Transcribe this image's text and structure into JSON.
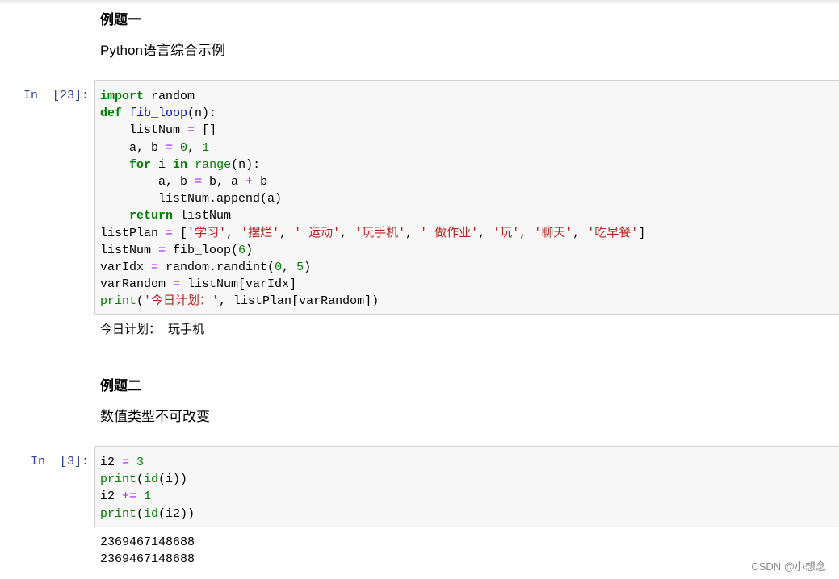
{
  "colors": {
    "keyword": "#008000",
    "builtin": "#008000",
    "number": "#008000",
    "operator": "#aa22ff",
    "string": "#ba2121",
    "function_def": "#0000ff",
    "prompt": "#303f9f"
  },
  "cells": [
    {
      "type": "markdown",
      "heading": "例题一",
      "paragraph": "Python语言综合示例"
    },
    {
      "type": "code",
      "prompt": "In  [23]:",
      "lines": [
        [
          {
            "t": "import",
            "c": "kw"
          },
          {
            "t": " random",
            "c": "n"
          }
        ],
        [
          {
            "t": "def",
            "c": "kw"
          },
          {
            "t": " ",
            "c": "n"
          },
          {
            "t": "fib_loop",
            "c": "fn"
          },
          {
            "t": "(n):",
            "c": "n"
          }
        ],
        [
          {
            "t": "    listNum ",
            "c": "n"
          },
          {
            "t": "=",
            "c": "op"
          },
          {
            "t": " []",
            "c": "n"
          }
        ],
        [
          {
            "t": "    a, b ",
            "c": "n"
          },
          {
            "t": "=",
            "c": "op"
          },
          {
            "t": " ",
            "c": "n"
          },
          {
            "t": "0",
            "c": "num"
          },
          {
            "t": ", ",
            "c": "n"
          },
          {
            "t": "1",
            "c": "num"
          }
        ],
        [
          {
            "t": "    ",
            "c": "n"
          },
          {
            "t": "for",
            "c": "kw"
          },
          {
            "t": " i ",
            "c": "n"
          },
          {
            "t": "in",
            "c": "kw"
          },
          {
            "t": " ",
            "c": "n"
          },
          {
            "t": "range",
            "c": "bi"
          },
          {
            "t": "(n):",
            "c": "n"
          }
        ],
        [
          {
            "t": "        a, b ",
            "c": "n"
          },
          {
            "t": "=",
            "c": "op"
          },
          {
            "t": " b, a ",
            "c": "n"
          },
          {
            "t": "+",
            "c": "op"
          },
          {
            "t": " b",
            "c": "n"
          }
        ],
        [
          {
            "t": "        listNum.append(a)",
            "c": "n"
          }
        ],
        [
          {
            "t": "    ",
            "c": "n"
          },
          {
            "t": "return",
            "c": "kw"
          },
          {
            "t": " listNum",
            "c": "n"
          }
        ],
        [
          {
            "t": "listPlan ",
            "c": "n"
          },
          {
            "t": "=",
            "c": "op"
          },
          {
            "t": " [",
            "c": "n"
          },
          {
            "t": "'学习'",
            "c": "str"
          },
          {
            "t": ", ",
            "c": "n"
          },
          {
            "t": "'摆烂'",
            "c": "str"
          },
          {
            "t": ", ",
            "c": "n"
          },
          {
            "t": "' 运动'",
            "c": "str"
          },
          {
            "t": ", ",
            "c": "n"
          },
          {
            "t": "'玩手机'",
            "c": "str"
          },
          {
            "t": ", ",
            "c": "n"
          },
          {
            "t": "' 做作业'",
            "c": "str"
          },
          {
            "t": ", ",
            "c": "n"
          },
          {
            "t": "'玩'",
            "c": "str"
          },
          {
            "t": ", ",
            "c": "n"
          },
          {
            "t": "'聊天'",
            "c": "str"
          },
          {
            "t": ", ",
            "c": "n"
          },
          {
            "t": "'吃早餐'",
            "c": "str"
          },
          {
            "t": "]",
            "c": "n"
          }
        ],
        [
          {
            "t": "listNum ",
            "c": "n"
          },
          {
            "t": "=",
            "c": "op"
          },
          {
            "t": " fib_loop(",
            "c": "n"
          },
          {
            "t": "6",
            "c": "num"
          },
          {
            "t": ")",
            "c": "n"
          }
        ],
        [
          {
            "t": "varIdx ",
            "c": "n"
          },
          {
            "t": "=",
            "c": "op"
          },
          {
            "t": " random.randint(",
            "c": "n"
          },
          {
            "t": "0",
            "c": "num"
          },
          {
            "t": ", ",
            "c": "n"
          },
          {
            "t": "5",
            "c": "num"
          },
          {
            "t": ")",
            "c": "n"
          }
        ],
        [
          {
            "t": "varRandom ",
            "c": "n"
          },
          {
            "t": "=",
            "c": "op"
          },
          {
            "t": " listNum[varIdx]",
            "c": "n"
          }
        ],
        [
          {
            "t": "print",
            "c": "bi"
          },
          {
            "t": "(",
            "c": "n"
          },
          {
            "t": "'今日计划：'",
            "c": "str"
          },
          {
            "t": ", listPlan[varRandom])",
            "c": "n"
          }
        ]
      ],
      "output": [
        "今日计划： 玩手机"
      ]
    },
    {
      "type": "markdown",
      "heading": "例题二",
      "paragraph": "数值类型不可改变"
    },
    {
      "type": "code",
      "prompt": "In  [3]:",
      "lines": [
        [
          {
            "t": "i2 ",
            "c": "n"
          },
          {
            "t": "=",
            "c": "op"
          },
          {
            "t": " ",
            "c": "n"
          },
          {
            "t": "3",
            "c": "num"
          }
        ],
        [
          {
            "t": "print",
            "c": "bi"
          },
          {
            "t": "(",
            "c": "n"
          },
          {
            "t": "id",
            "c": "bi"
          },
          {
            "t": "(i))",
            "c": "n"
          }
        ],
        [
          {
            "t": "i2 ",
            "c": "n"
          },
          {
            "t": "+=",
            "c": "op"
          },
          {
            "t": " ",
            "c": "n"
          },
          {
            "t": "1",
            "c": "num"
          }
        ],
        [
          {
            "t": "print",
            "c": "bi"
          },
          {
            "t": "(",
            "c": "n"
          },
          {
            "t": "id",
            "c": "bi"
          },
          {
            "t": "(i2))",
            "c": "n"
          }
        ]
      ],
      "output": [
        "2369467148688",
        "2369467148688"
      ]
    }
  ],
  "watermark": "CSDN @小想念"
}
